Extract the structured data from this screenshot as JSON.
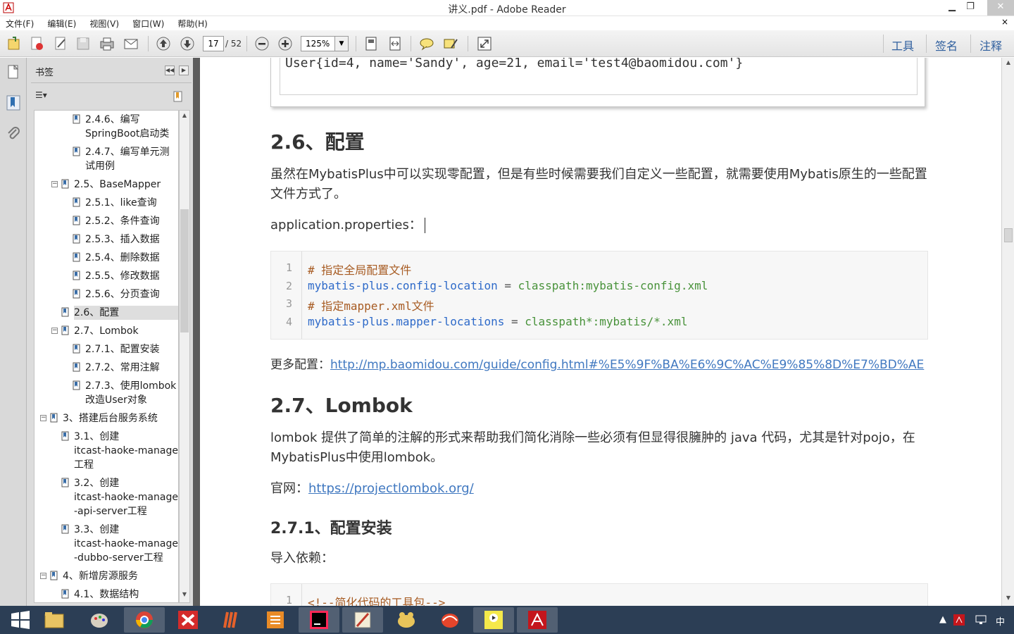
{
  "window": {
    "title": "讲义.pdf - Adobe Reader",
    "min": "▁",
    "max": "❐",
    "close": "✕"
  },
  "menu": [
    "文件(F)",
    "编辑(E)",
    "视图(V)",
    "窗口(W)",
    "帮助(H)"
  ],
  "menu_close": "×",
  "toolbar": {
    "page_current": "17",
    "page_total": "/ 52",
    "zoom": "125%",
    "zoom_arrow": "▼",
    "tabs": [
      "工具",
      "签名",
      "注释"
    ]
  },
  "bookmarks": {
    "title": "书签",
    "collapse_left": "◀◀",
    "collapse_right": "▶",
    "options": "☰▾",
    "items": [
      {
        "text": "2.4.6、编写",
        "text2": "SpringBoot启动类"
      },
      {
        "text": "2.4.7、编写单元测",
        "text2": "试用例"
      },
      {
        "text": "2.5、BaseMapper"
      },
      {
        "text": "2.5.1、like查询"
      },
      {
        "text": "2.5.2、条件查询"
      },
      {
        "text": "2.5.3、插入数据"
      },
      {
        "text": "2.5.4、删除数据"
      },
      {
        "text": "2.5.5、修改数据"
      },
      {
        "text": "2.5.6、分页查询"
      },
      {
        "text": "2.6、配置"
      },
      {
        "text": "2.7、Lombok"
      },
      {
        "text": "2.7.1、配置安装"
      },
      {
        "text": "2.7.2、常用注解"
      },
      {
        "text": "2.7.3、使用lombok",
        "text2": "改造User对象"
      },
      {
        "text": "3、搭建后台服务系统"
      },
      {
        "text": "3.1、创建",
        "text2": "itcast-haoke-manage",
        "text3": "工程"
      },
      {
        "text": "3.2、创建",
        "text2": "itcast-haoke-manage",
        "text3": "-api-server工程"
      },
      {
        "text": "3.3、创建",
        "text2": "itcast-haoke-manage",
        "text3": "-dubbo-server工程"
      },
      {
        "text": "4、新增房源服务"
      },
      {
        "text": "4.1、数据结构"
      }
    ],
    "expanders": [
      "−",
      "−",
      "−",
      "−"
    ]
  },
  "doc": {
    "prev_code": "User{id=4, name='Sandy', age=21, email='test4@baomidou.com'}",
    "h_config": "2.6、配置",
    "p_config": "虽然在MybatisPlus中可以实现零配置，但是有些时候需要我们自定义一些配置，就需要使用Mybatis原生的一些配置文件方式了。",
    "p_app": "application.properties：",
    "code1": {
      "lines": [
        {
          "n": "1",
          "comment": "# 指定全局配置文件"
        },
        {
          "n": "2",
          "key": "mybatis-plus.config-location",
          "op": " = ",
          "val": "classpath:mybatis-config.xml"
        },
        {
          "n": "3",
          "comment": "# 指定mapper.xml文件"
        },
        {
          "n": "4",
          "key": "mybatis-plus.mapper-locations",
          "op": " = ",
          "val": "classpath*:mybatis/*.xml"
        }
      ]
    },
    "more_label": "更多配置：",
    "more_link": "http://mp.baomidou.com/guide/config.html#%E5%9F%BA%E6%9C%AC%E9%85%8D%E7%BD%AE",
    "h_lombok": "2.7、Lombok",
    "p_lombok": "lombok 提供了简单的注解的形式来帮助我们简化消除一些必须有但显得很臃肿的 java 代码，尤其是针对pojo，在MybatisPlus中使用lombok。",
    "site_label": "官网：",
    "site_link": "https://projectlombok.org/",
    "h_install": "2.7.1、配置安装",
    "p_import": "导入依赖：",
    "code2_line_n": "1",
    "code2_line": "<!--简化代码的工具包-->"
  },
  "tray": {
    "ime": "中"
  }
}
